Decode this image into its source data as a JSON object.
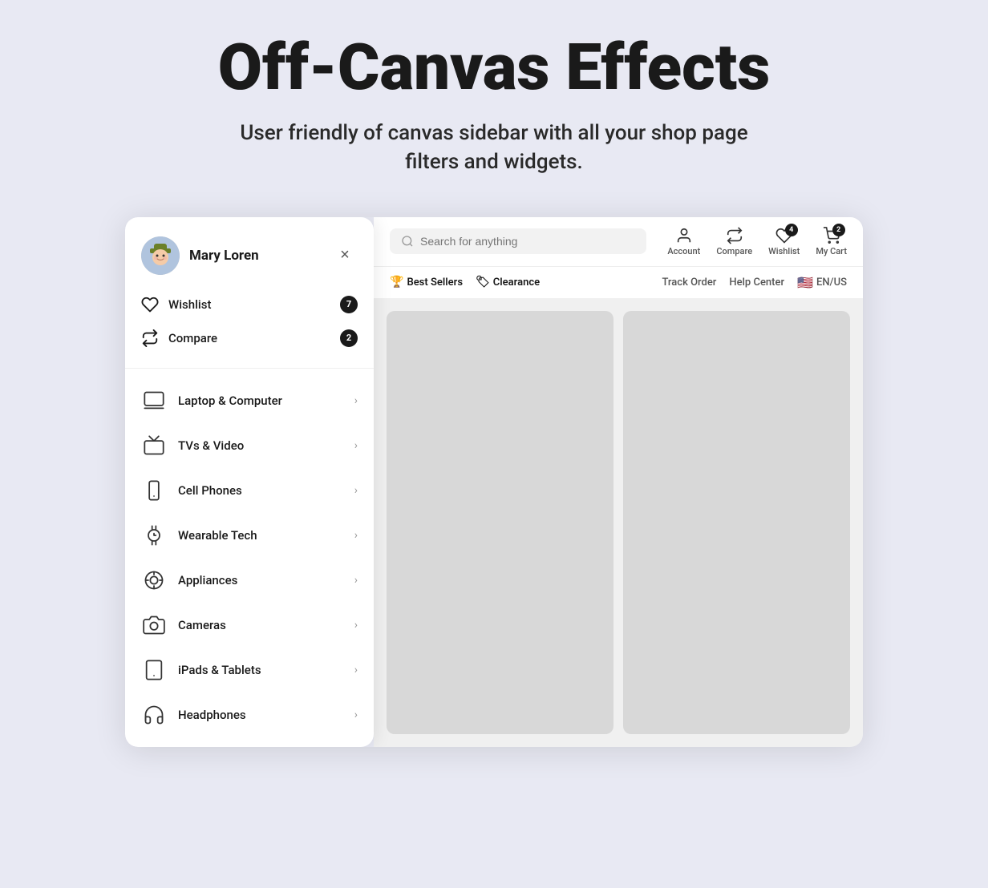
{
  "hero": {
    "title": "Off-Canvas Effects",
    "subtitle": "User friendly of canvas sidebar with all your shop page filters and widgets."
  },
  "sidebar": {
    "user": {
      "name": "Mary Loren",
      "avatar_emoji": "🧑"
    },
    "actions": [
      {
        "id": "wishlist",
        "label": "Wishlist",
        "count": 7
      },
      {
        "id": "compare",
        "label": "Compare",
        "count": 2
      }
    ],
    "nav_items": [
      {
        "id": "laptop",
        "label": "Laptop & Computer",
        "icon": "laptop-icon"
      },
      {
        "id": "tv",
        "label": "TVs & Video",
        "icon": "tv-icon"
      },
      {
        "id": "cell",
        "label": "Cell Phones",
        "icon": "phone-icon"
      },
      {
        "id": "wearable",
        "label": "Wearable Tech",
        "icon": "watch-icon"
      },
      {
        "id": "appliances",
        "label": "Appliances",
        "icon": "appliance-icon"
      },
      {
        "id": "cameras",
        "label": "Cameras",
        "icon": "camera-icon"
      },
      {
        "id": "ipads",
        "label": "iPads & Tablets",
        "icon": "tablet-icon"
      },
      {
        "id": "headphones",
        "label": "Headphones",
        "icon": "headphones-icon"
      }
    ],
    "close_label": "×"
  },
  "topbar": {
    "search_placeholder": "Search for anything",
    "icons": [
      {
        "id": "account",
        "label": "Account",
        "badge": null
      },
      {
        "id": "compare",
        "label": "Compare",
        "badge": null
      },
      {
        "id": "wishlist",
        "label": "Wishlist",
        "badge": 4
      },
      {
        "id": "cart",
        "label": "My Cart",
        "badge": 2
      }
    ]
  },
  "navbar": {
    "links": [
      {
        "id": "best-sellers",
        "label": "Best Sellers",
        "special": true
      },
      {
        "id": "clearance",
        "label": "Clearance",
        "special": true
      }
    ],
    "right_links": [
      {
        "id": "track-order",
        "label": "Track Order"
      },
      {
        "id": "help-center",
        "label": "Help Center"
      },
      {
        "id": "locale",
        "label": "EN/US"
      }
    ]
  }
}
